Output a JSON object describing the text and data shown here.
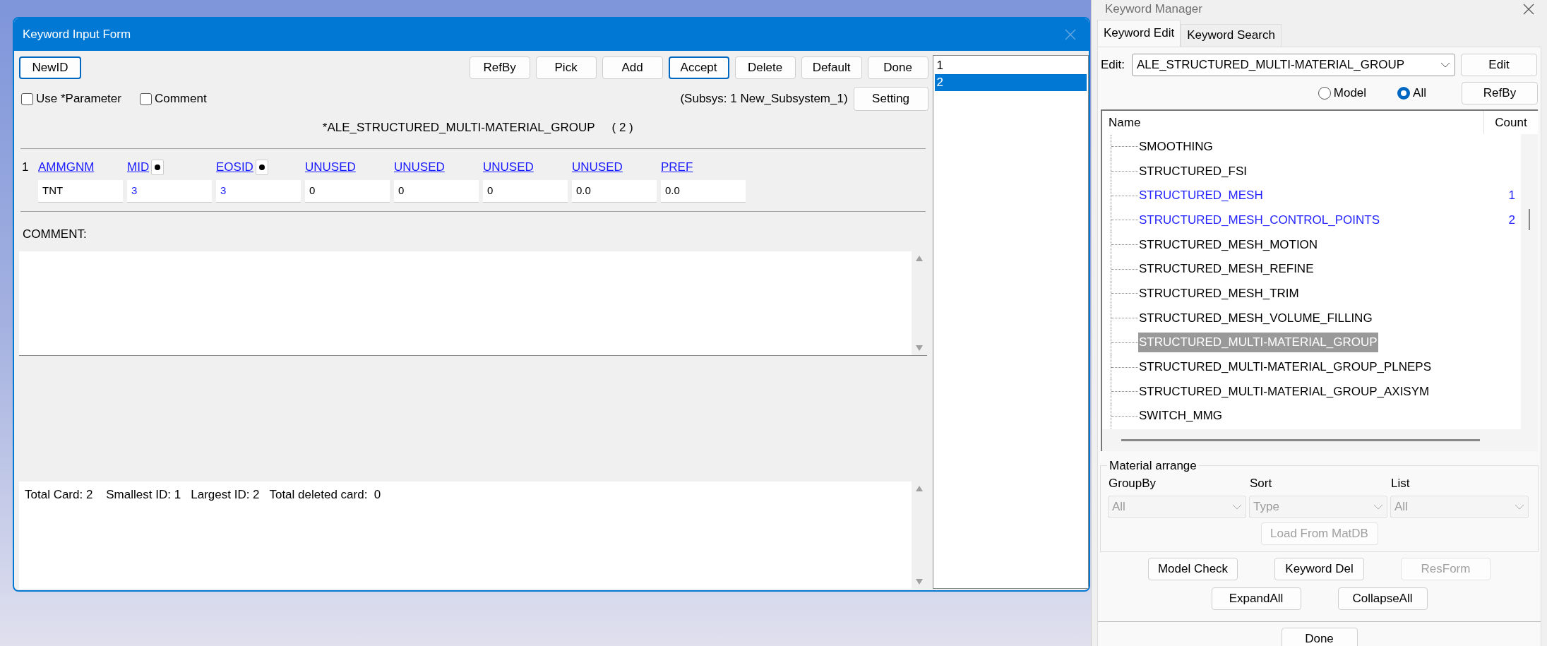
{
  "input_form": {
    "title": "Keyword Input Form",
    "left_buttons": [
      {
        "label": "NewID",
        "focused": true
      }
    ],
    "right_buttons": [
      {
        "label": "RefBy",
        "focused": false
      },
      {
        "label": "Pick",
        "focused": false
      },
      {
        "label": "Add",
        "focused": false
      },
      {
        "label": "Accept",
        "focused": true
      },
      {
        "label": "Delete",
        "focused": false
      },
      {
        "label": "Default",
        "focused": false
      },
      {
        "label": "Done",
        "focused": false
      }
    ],
    "checkboxes": [
      {
        "label": "Use *Parameter",
        "checked": false
      },
      {
        "label": "Comment",
        "checked": false
      }
    ],
    "subsystem": "(Subsys: 1 New_Subsystem_1)",
    "setting_button": "Setting",
    "keyword": "*ALE_STRUCTURED_MULTI-MATERIAL_GROUP",
    "keyword_id": "( 2 )",
    "card": {
      "row_number": "1",
      "fields": [
        {
          "label": "AMMGNM",
          "value": "TNT",
          "linked": false,
          "picker": false
        },
        {
          "label": "MID",
          "value": "3",
          "linked": true,
          "picker": true
        },
        {
          "label": "EOSID",
          "value": "3",
          "linked": true,
          "picker": true
        },
        {
          "label": "UNUSED",
          "value": "0",
          "linked": false,
          "picker": false
        },
        {
          "label": "UNUSED",
          "value": "0",
          "linked": false,
          "picker": false
        },
        {
          "label": "UNUSED",
          "value": "0",
          "linked": false,
          "picker": false
        },
        {
          "label": "UNUSED",
          "value": "0.0",
          "linked": false,
          "picker": false
        },
        {
          "label": "PREF",
          "value": "0.0",
          "linked": false,
          "picker": false
        }
      ]
    },
    "comment_label": "COMMENT:",
    "summary": "Total Card: 2    Smallest ID: 1   Largest ID: 2   Total deleted card:  0",
    "id_list": [
      {
        "label": "1",
        "selected": false
      },
      {
        "label": "2",
        "selected": true
      }
    ]
  },
  "keyword_manager": {
    "title": "Keyword Manager",
    "tabs": [
      {
        "label": "Keyword Edit",
        "selected": true
      },
      {
        "label": "Keyword Search",
        "selected": false
      }
    ],
    "edit_label": "Edit:",
    "edit_value": "ALE_STRUCTURED_MULTI-MATERIAL_GROUP",
    "edit_button": "Edit",
    "radios": [
      {
        "label": "Model",
        "selected": false
      },
      {
        "label": "All",
        "selected": true
      }
    ],
    "refby_button": "RefBy",
    "tree_columns": [
      "Name",
      "Count"
    ],
    "tree_items": [
      {
        "name": "SMOOTHING",
        "used": false,
        "selected": false
      },
      {
        "name": "STRUCTURED_FSI",
        "used": false,
        "selected": false
      },
      {
        "name": "STRUCTURED_MESH",
        "count": "1",
        "used": true,
        "selected": false
      },
      {
        "name": "STRUCTURED_MESH_CONTROL_POINTS",
        "count": "2",
        "used": true,
        "selected": false
      },
      {
        "name": "STRUCTURED_MESH_MOTION",
        "used": false,
        "selected": false
      },
      {
        "name": "STRUCTURED_MESH_REFINE",
        "used": false,
        "selected": false
      },
      {
        "name": "STRUCTURED_MESH_TRIM",
        "used": false,
        "selected": false
      },
      {
        "name": "STRUCTURED_MESH_VOLUME_FILLING",
        "used": false,
        "selected": false
      },
      {
        "name": "STRUCTURED_MULTI-MATERIAL_GROUP",
        "used": false,
        "selected": true
      },
      {
        "name": "STRUCTURED_MULTI-MATERIAL_GROUP_PLNEPS",
        "used": false,
        "selected": false
      },
      {
        "name": "STRUCTURED_MULTI-MATERIAL_GROUP_AXISYM",
        "used": false,
        "selected": false
      },
      {
        "name": "SWITCH_MMG",
        "used": false,
        "selected": false
      }
    ],
    "material_arrange": {
      "title": "Material arrange",
      "selects": [
        {
          "label": "GroupBy",
          "value": "All",
          "disabled": true
        },
        {
          "label": "Sort",
          "value": "Type",
          "disabled": true
        },
        {
          "label": "List",
          "value": "All",
          "disabled": true
        }
      ],
      "load_button": {
        "label": "Load From MatDB",
        "disabled": true
      }
    },
    "button_rows": [
      [
        {
          "label": "Model Check",
          "disabled": false
        },
        {
          "label": "Keyword Del",
          "disabled": false
        },
        {
          "label": "ResForm",
          "disabled": true
        }
      ],
      [
        {
          "label": "ExpandAll",
          "disabled": false
        },
        {
          "label": "CollapseAll",
          "disabled": false
        }
      ]
    ],
    "done_button": "Done"
  }
}
